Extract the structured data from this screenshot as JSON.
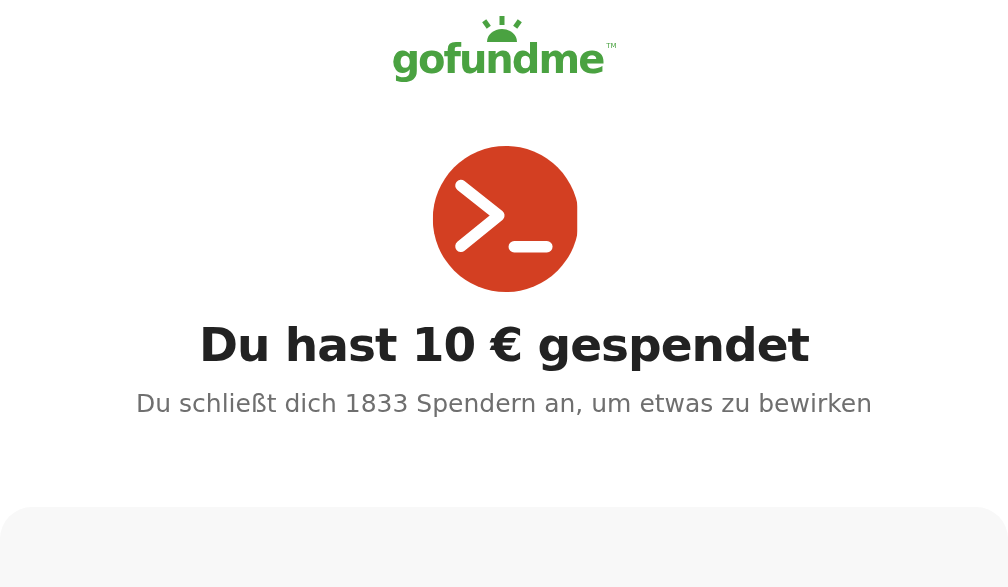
{
  "logo": {
    "text": "gofundme",
    "trademark": "TM"
  },
  "title": "Du hast 10 € gespendet",
  "subtitle": "Du schließt dich 1833 Spendern an, um etwas zu bewirken"
}
